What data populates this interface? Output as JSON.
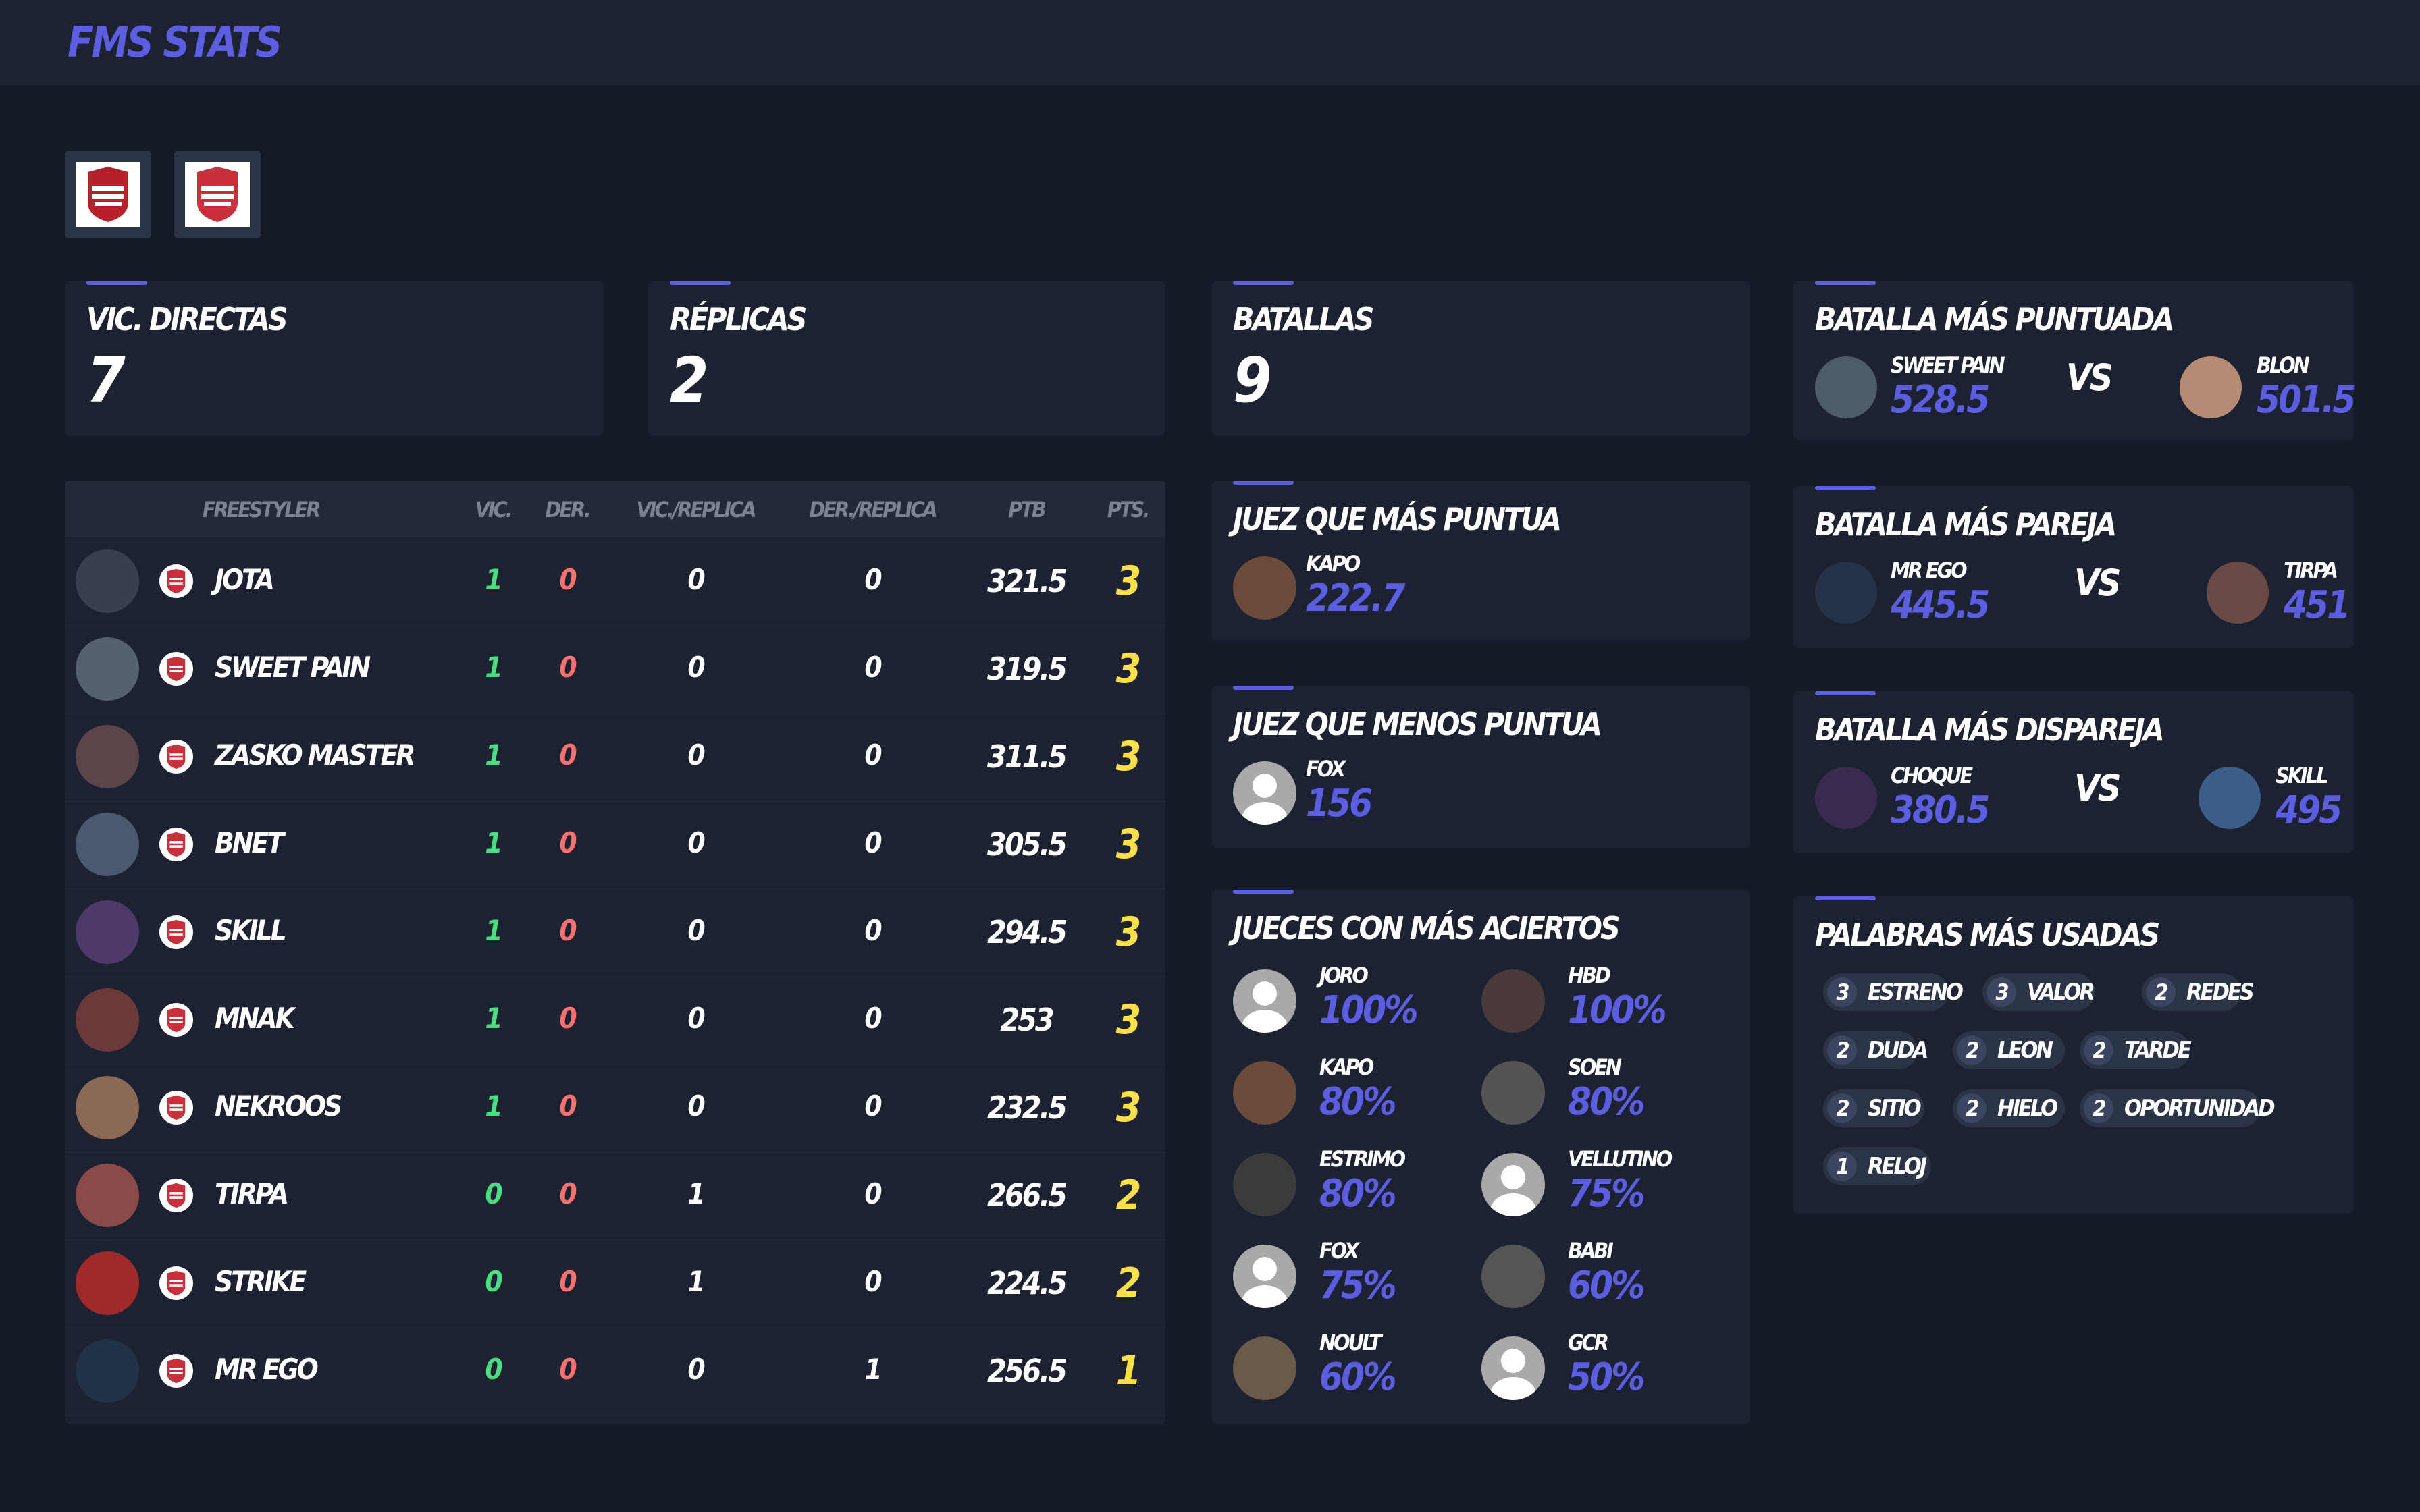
{
  "app": {
    "title": "FMS STATS"
  },
  "stats": {
    "vic_directas": {
      "label": "VIC. DIRECTAS",
      "value": "7"
    },
    "replicas": {
      "label": "RÉPLICAS",
      "value": "2"
    },
    "batallas": {
      "label": "BATALLAS",
      "value": "9"
    }
  },
  "battle_top": {
    "title": "BATALLA MÁS PUNTUADA",
    "left": {
      "name": "SWEET PAIN",
      "score": "528.5"
    },
    "right": {
      "name": "BLON",
      "score": "501.5"
    },
    "vs": "VS"
  },
  "battle_even": {
    "title": "BATALLA MÁS PAREJA",
    "left": {
      "name": "MR EGO",
      "score": "445.5"
    },
    "right": {
      "name": "TIRPA",
      "score": "451"
    },
    "vs": "VS"
  },
  "battle_uneven": {
    "title": "BATALLA MÁS DISPAREJA",
    "left": {
      "name": "CHOQUE",
      "score": "380.5"
    },
    "right": {
      "name": "SKILL",
      "score": "495"
    },
    "vs": "VS"
  },
  "judge_most": {
    "title": "JUEZ QUE MÁS PUNTUA",
    "name": "KAPO",
    "score": "222.7"
  },
  "judge_least": {
    "title": "JUEZ QUE MENOS PUNTUA",
    "name": "FOX",
    "score": "156"
  },
  "judges_hits": {
    "title": "JUECES CON MÁS ACIERTOS",
    "items": [
      {
        "name": "JORO",
        "pct": "100%",
        "photo": false
      },
      {
        "name": "HBD",
        "pct": "100%",
        "photo": true
      },
      {
        "name": "KAPO",
        "pct": "80%",
        "photo": true
      },
      {
        "name": "SOEN",
        "pct": "80%",
        "photo": true
      },
      {
        "name": "ESTRIMO",
        "pct": "80%",
        "photo": true
      },
      {
        "name": "VELLUTINO",
        "pct": "75%",
        "photo": false
      },
      {
        "name": "FOX",
        "pct": "75%",
        "photo": false
      },
      {
        "name": "BABI",
        "pct": "60%",
        "photo": true
      },
      {
        "name": "NOULT",
        "pct": "60%",
        "photo": true
      },
      {
        "name": "GCR",
        "pct": "50%",
        "photo": false
      }
    ]
  },
  "words": {
    "title": "PALABRAS MÁS USADAS",
    "items": [
      {
        "count": "3",
        "word": "ESTRENO"
      },
      {
        "count": "3",
        "word": "VALOR"
      },
      {
        "count": "2",
        "word": "REDES"
      },
      {
        "count": "2",
        "word": "DUDA"
      },
      {
        "count": "2",
        "word": "LEON"
      },
      {
        "count": "2",
        "word": "TARDE"
      },
      {
        "count": "2",
        "word": "SITIO"
      },
      {
        "count": "2",
        "word": "HIELO"
      },
      {
        "count": "2",
        "word": "OPORTUNIDAD"
      },
      {
        "count": "1",
        "word": "RELOJ"
      }
    ]
  },
  "table": {
    "headers": {
      "freestyler": "FREESTYLER",
      "vic": "VIC.",
      "der": "DER.",
      "vic_replica": "VIC./REPLICA",
      "der_replica": "DER./REPLICA",
      "ptb": "PTB",
      "pts": "PTS."
    },
    "rows": [
      {
        "name": "JOTA",
        "vic": "1",
        "der": "0",
        "vr": "0",
        "dr": "0",
        "ptb": "321.5",
        "pts": "3"
      },
      {
        "name": "SWEET PAIN",
        "vic": "1",
        "der": "0",
        "vr": "0",
        "dr": "0",
        "ptb": "319.5",
        "pts": "3"
      },
      {
        "name": "ZASKO MASTER",
        "vic": "1",
        "der": "0",
        "vr": "0",
        "dr": "0",
        "ptb": "311.5",
        "pts": "3"
      },
      {
        "name": "BNET",
        "vic": "1",
        "der": "0",
        "vr": "0",
        "dr": "0",
        "ptb": "305.5",
        "pts": "3"
      },
      {
        "name": "SKILL",
        "vic": "1",
        "der": "0",
        "vr": "0",
        "dr": "0",
        "ptb": "294.5",
        "pts": "3"
      },
      {
        "name": "MNAK",
        "vic": "1",
        "der": "0",
        "vr": "0",
        "dr": "0",
        "ptb": "253",
        "pts": "3"
      },
      {
        "name": "NEKROOS",
        "vic": "1",
        "der": "0",
        "vr": "0",
        "dr": "0",
        "ptb": "232.5",
        "pts": "3"
      },
      {
        "name": "TIRPA",
        "vic": "0",
        "der": "0",
        "vr": "1",
        "dr": "0",
        "ptb": "266.5",
        "pts": "2"
      },
      {
        "name": "STRIKE",
        "vic": "0",
        "der": "0",
        "vr": "1",
        "dr": "0",
        "ptb": "224.5",
        "pts": "2"
      },
      {
        "name": "MR EGO",
        "vic": "0",
        "der": "0",
        "vr": "0",
        "dr": "1",
        "ptb": "256.5",
        "pts": "1"
      }
    ]
  },
  "colors": {
    "accent": "#5b5ee0",
    "win": "#4ade80",
    "loss": "#f87171",
    "pts": "#fde047"
  }
}
